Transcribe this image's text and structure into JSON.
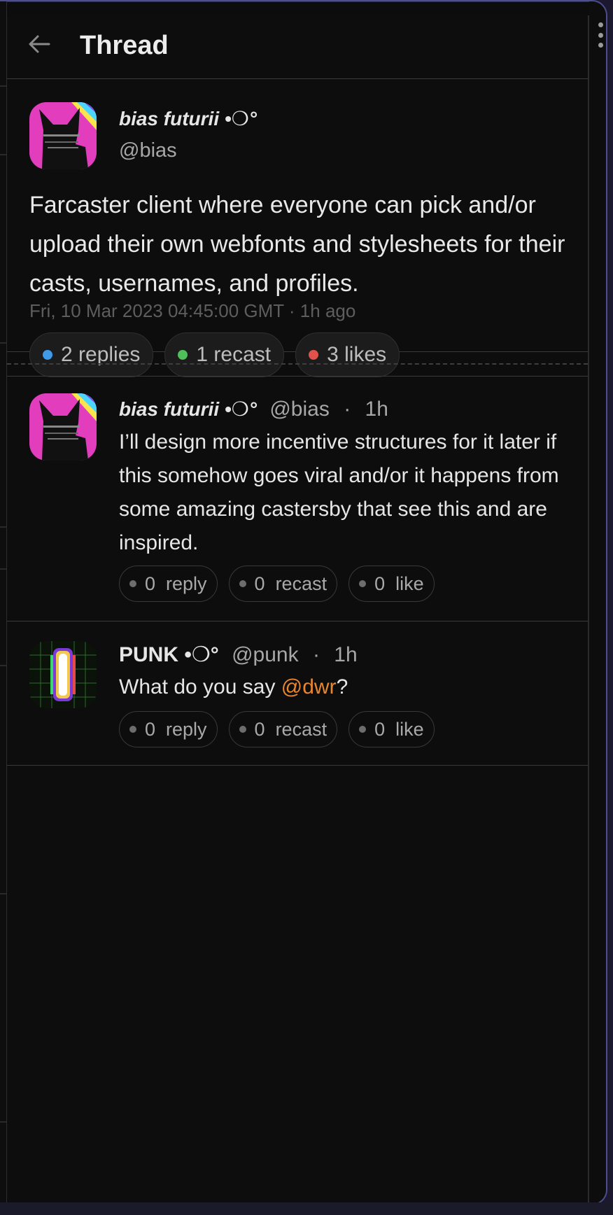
{
  "header": {
    "title": "Thread",
    "back_icon": "arrow-left-icon"
  },
  "main_post": {
    "display_name": "bias futurii •❍°",
    "handle": "@bias",
    "text": "Farcaster client where everyone can pick and/or upload their own webfonts and stylesheets for their casts, usernames, and profiles.",
    "timestamp": "Fri, 10 Mar 2023 04:45:00 GMT · 1h ago",
    "actions": {
      "replies": "2 replies",
      "recasts": "1 recast",
      "likes": "3 likes"
    },
    "colors": {
      "replies_dot": "#3f9be8",
      "recasts_dot": "#4fbf5a",
      "likes_dot": "#e0524a"
    }
  },
  "replies": [
    {
      "display_name": "bias futurii •❍°",
      "handle": "@bias",
      "separator": "·",
      "time": "1h",
      "text": "I’ll design more incentive structures for it later if this somehow goes viral and/or it happens from some amazing castersby that see this and are inspired.",
      "actions": {
        "reply": "0  reply",
        "recast": "0  recast",
        "like": "0  like"
      }
    },
    {
      "display_name": "PUNK •❍°",
      "handle": "@punk",
      "separator": "·",
      "time": "1h",
      "text_before": "What do you say ",
      "mention": "@dwr",
      "text_after": "?",
      "actions": {
        "reply": "0  reply",
        "recast": "0  recast",
        "like": "0  like"
      }
    }
  ],
  "colors": {
    "background": "#0e0d0d",
    "mention": "#e6862f",
    "window_border": "#4b4f8e"
  }
}
